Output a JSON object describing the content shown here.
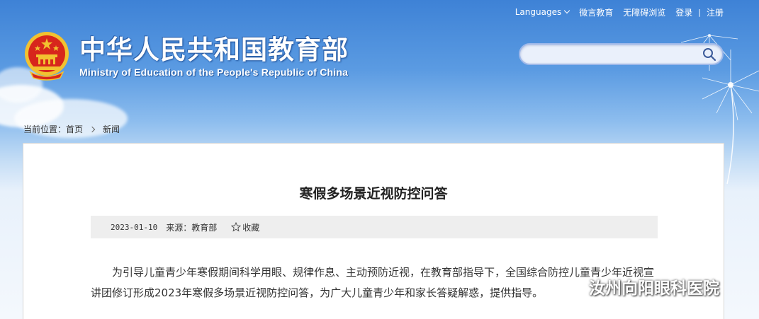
{
  "header": {
    "languages_label": "Languages",
    "links": [
      "微言教育",
      "无障碍浏览",
      "登录",
      "注册"
    ],
    "login_register_separator": "|",
    "site_title_cn": "中华人民共和国教育部",
    "site_title_en": "Ministry of Education of the People's Republic of China",
    "search_placeholder": ""
  },
  "breadcrumb": {
    "label": "当前位置：",
    "items": [
      "首页",
      "新闻"
    ]
  },
  "article": {
    "title": "寒假多场景近视防控问答",
    "date": "2023-01-10",
    "source": "来源：教育部",
    "favorite_label": "收藏",
    "paragraph": "为引导儿童青少年寒假期间科学用眼、规律作息、主动预防近视，在教育部指导下，全国综合防控儿童青少年近视宣讲团修订形成2023年寒假多场景近视防控问答，为广大儿童青少年和家长答疑解惑，提供指导。"
  },
  "watermark": {
    "text": "汝州向阳眼科医院"
  },
  "colors": {
    "header_blue": "#3e82d6",
    "emblem_red": "#d7261c",
    "emblem_gold": "#f2c230",
    "meta_bar": "#eeeeee"
  }
}
